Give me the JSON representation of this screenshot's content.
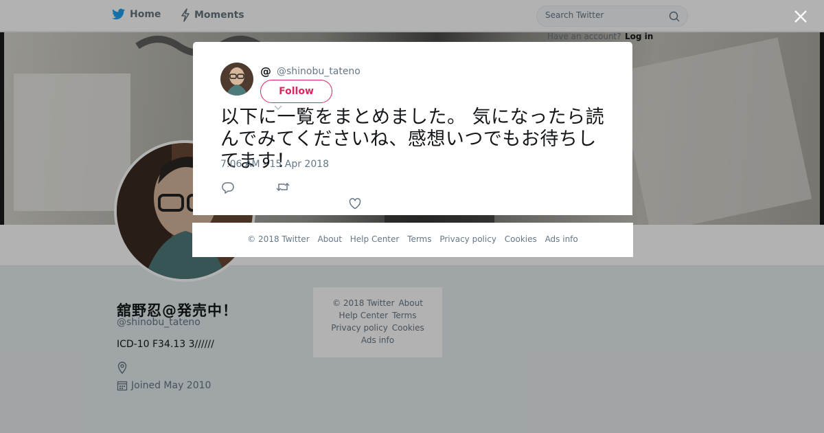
{
  "nav": {
    "home_label": "Home",
    "moments_label": "Moments"
  },
  "search": {
    "placeholder": "Search Twitter"
  },
  "login": {
    "hint": "Have an account?",
    "link": "Log in"
  },
  "profile": {
    "name": "舘野忍@発売中！",
    "handle": "@shinobu_tateno",
    "bio": "ICD-10 F34.13 3//////",
    "joined": "Joined May 2010"
  },
  "side_footer": {
    "copyright": "© 2018 Twitter",
    "about": "About",
    "help": "Help Center",
    "terms": "Terms",
    "privacy": "Privacy policy",
    "cookies": "Cookies",
    "ads": "Ads info"
  },
  "tweet": {
    "at_symbol": "@",
    "handle": "@shinobu_tateno",
    "follow_label": "Follow",
    "text": "以下に一覧をまとめました。 気になったら読んでみてくださいね、感想いつでもお待ちしてます！",
    "timestamp": "7:06 AM - 15 Apr 2018"
  },
  "modal_footer": {
    "copyright": "© 2018 Twitter",
    "about": "About",
    "help": "Help Center",
    "terms": "Terms",
    "privacy": "Privacy policy",
    "cookies": "Cookies",
    "ads": "Ads info"
  },
  "colors": {
    "accent": "#e0245e",
    "twitter_blue": "#1da1f2",
    "muted": "#657786",
    "overlay": "rgba(0,0,0,0.30)"
  },
  "icons": [
    "twitter-bird-icon",
    "lightning-icon",
    "search-icon",
    "close-icon",
    "reply-icon",
    "retweet-icon",
    "heart-icon",
    "location-icon",
    "calendar-icon",
    "caret-down-icon"
  ]
}
